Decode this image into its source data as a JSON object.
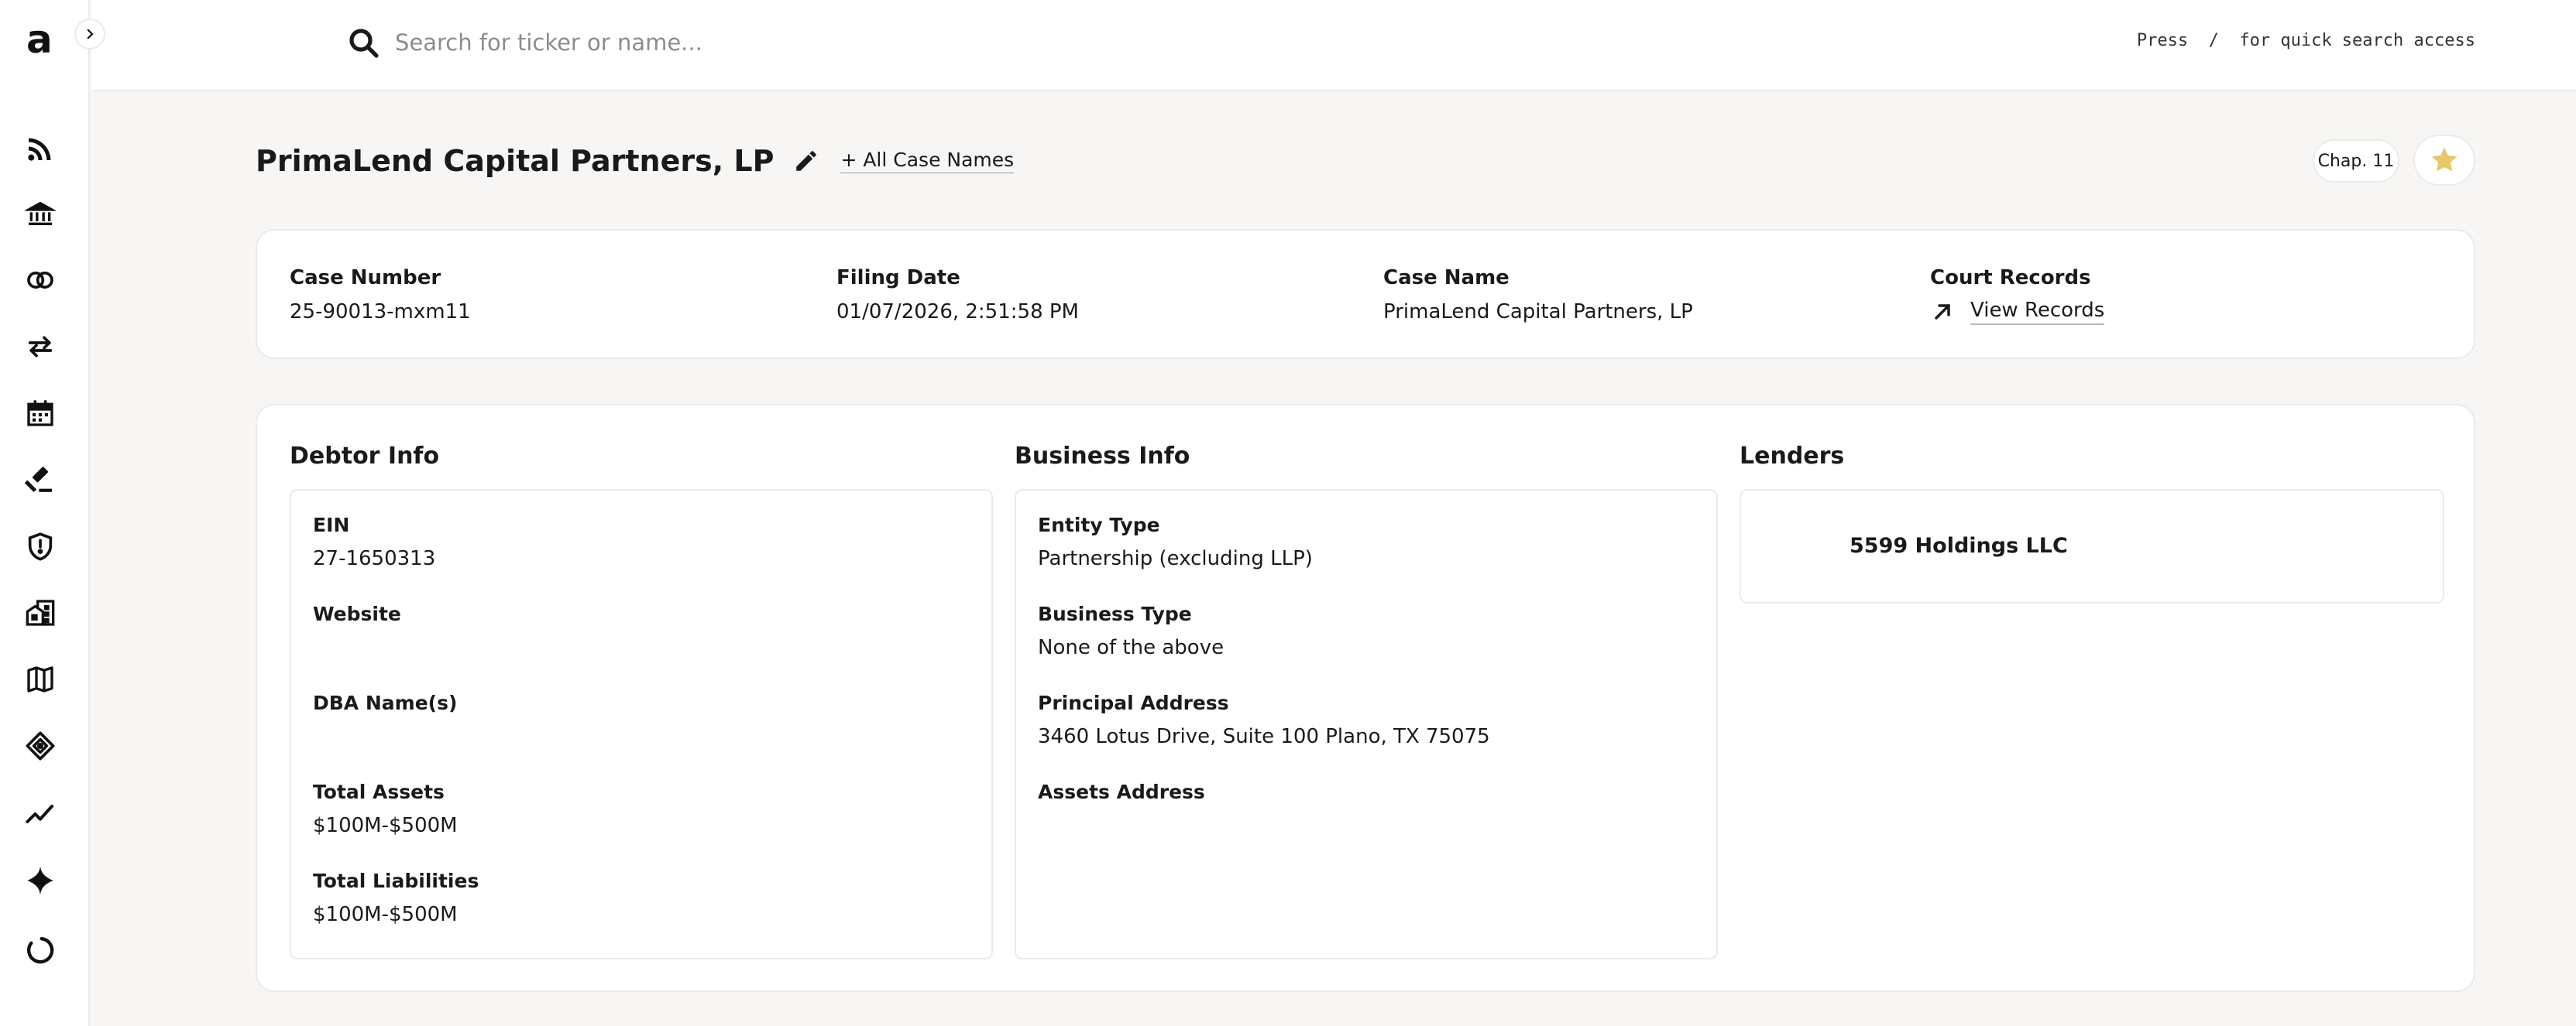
{
  "app": {
    "logo": "a"
  },
  "search": {
    "placeholder": "Search for ticker or name...",
    "hint": "Press  /  for quick search access"
  },
  "sidebar": {
    "items": [
      {
        "icon": "rss-icon"
      },
      {
        "icon": "bank-icon"
      },
      {
        "icon": "rings-icon"
      },
      {
        "icon": "transfer-arrows-icon"
      },
      {
        "icon": "calendar-icon"
      },
      {
        "icon": "gavel-icon"
      },
      {
        "icon": "shield-icon"
      },
      {
        "icon": "buildings-icon"
      },
      {
        "icon": "map-icon"
      },
      {
        "icon": "tag-icon"
      },
      {
        "icon": "trend-line-icon"
      },
      {
        "icon": "sparkle-icon"
      },
      {
        "icon": "progress-ring-icon"
      }
    ]
  },
  "header": {
    "title": "PrimaLend Capital Partners, LP",
    "all_case_names": "+ All Case Names",
    "chapter_badge": "Chap. 11",
    "star_color": "#e8c66a"
  },
  "summary": {
    "case_number_label": "Case Number",
    "case_number": "25-90013-mxm11",
    "filing_date_label": "Filing Date",
    "filing_date": "01/07/2026, 2:51:58 PM",
    "case_name_label": "Case Name",
    "case_name": "PrimaLend Capital Partners, LP",
    "court_records_label": "Court Records",
    "view_records": "View Records"
  },
  "debtor_info": {
    "title": "Debtor Info",
    "ein_label": "EIN",
    "ein": "27-1650313",
    "website_label": "Website",
    "website": "",
    "dba_label": "DBA Name(s)",
    "dba": "",
    "total_assets_label": "Total Assets",
    "total_assets": "$100M-$500M",
    "total_liabilities_label": "Total Liabilities",
    "total_liabilities": "$100M-$500M"
  },
  "business_info": {
    "title": "Business Info",
    "entity_type_label": "Entity Type",
    "entity_type": "Partnership (excluding LLP)",
    "business_type_label": "Business Type",
    "business_type": "None of the above",
    "principal_address_label": "Principal Address",
    "principal_address": "3460 Lotus Drive, Suite 100 Plano, TX 75075",
    "assets_address_label": "Assets Address",
    "assets_address": ""
  },
  "lenders": {
    "title": "Lenders",
    "items": [
      "5599 Holdings LLC"
    ]
  }
}
